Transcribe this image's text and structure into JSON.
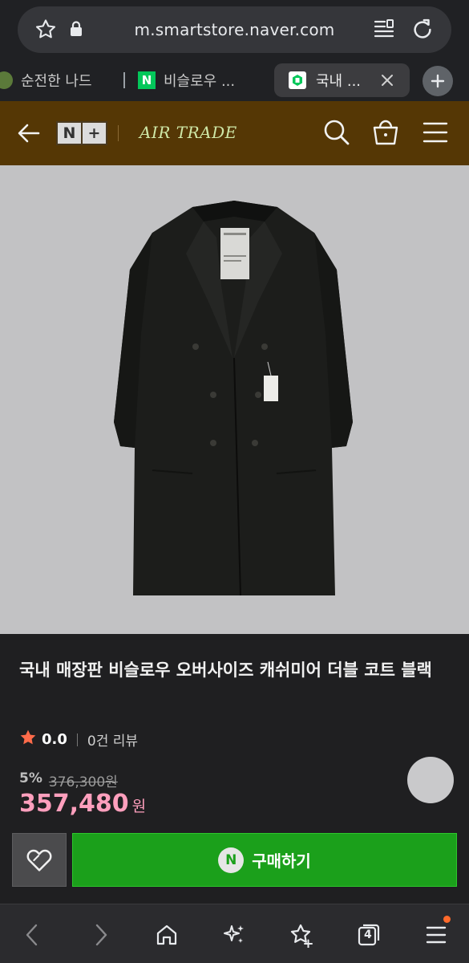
{
  "browser": {
    "url": "m.smartstore.naver.com",
    "tabs": [
      {
        "label": "순전한 나드"
      },
      {
        "label": "비슬로우 ..."
      },
      {
        "label": "국내 ...",
        "active": true
      }
    ],
    "tab_count": "4"
  },
  "store_header": {
    "logo_left": "N",
    "logo_right": "+",
    "brand_name": "AIR TRADE"
  },
  "product": {
    "title": "국내 매장판 비슬로우 오버사이즈 캐쉬미어 더블 코트 블랙",
    "rating": "0.0",
    "review_count": "0건 리뷰",
    "discount_rate": "5%",
    "original_price": "376,300원",
    "price": "357,480",
    "currency": "원",
    "buy_label": "구매하기",
    "npay_label": "N"
  },
  "colors": {
    "header_bg": "#553705",
    "price": "#ff9fbd",
    "buy_button": "#1ba01b",
    "star": "#ff6b4a"
  }
}
